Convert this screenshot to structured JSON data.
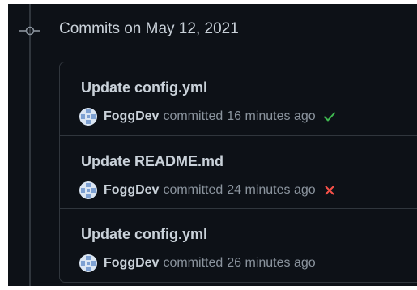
{
  "timeline": {
    "group_heading": "Commits on May 12, 2021"
  },
  "colors": {
    "background": "#0d1117",
    "border": "#30363d",
    "text_primary": "#c9d1d9",
    "text_muted": "#8b949e",
    "success": "#3fb950",
    "failure": "#f85149"
  },
  "commits": [
    {
      "title": "Update config.yml",
      "author": "FoggDev",
      "action": "committed",
      "time": "16 minutes ago",
      "status_icon": "check-icon"
    },
    {
      "title": "Update README.md",
      "author": "FoggDev",
      "action": "committed",
      "time": "24 minutes ago",
      "status_icon": "x-icon"
    },
    {
      "title": "Update config.yml",
      "author": "FoggDev",
      "action": "committed",
      "time": "26 minutes ago",
      "status_icon": ""
    }
  ]
}
